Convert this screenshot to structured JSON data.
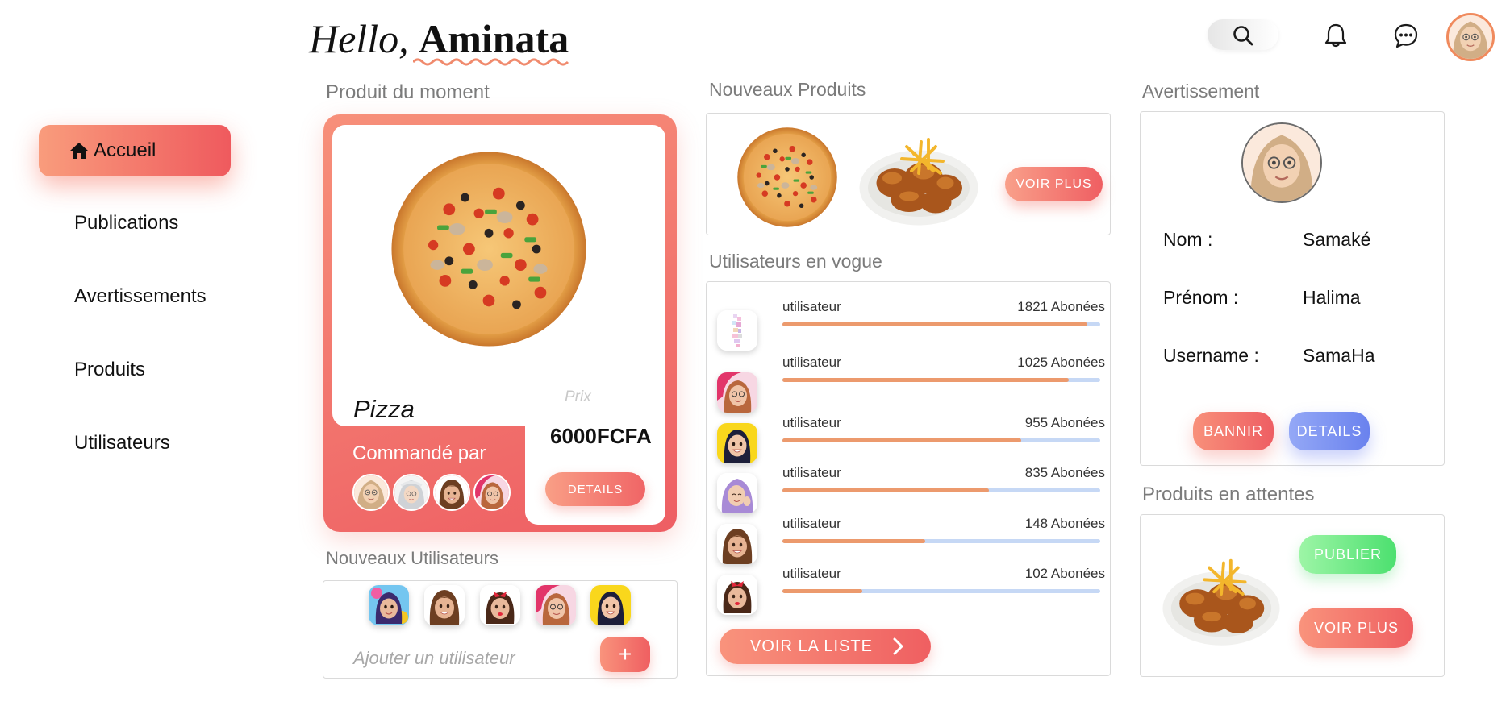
{
  "greeting": {
    "hello": "Hello,",
    "name": "Aminata"
  },
  "topbar": {
    "icons": [
      "search-icon",
      "bell-icon",
      "chat-icon",
      "avatar"
    ]
  },
  "sidebar": {
    "items": [
      {
        "label": "Accueil",
        "icon": "home-icon",
        "active": true
      },
      {
        "label": "Publications"
      },
      {
        "label": "Avertissements"
      },
      {
        "label": "Produits"
      },
      {
        "label": "Utilisateurs"
      }
    ]
  },
  "featured": {
    "title": "Produit du moment",
    "name": "Pizza",
    "price_label": "Prix",
    "price": "6000FCFA",
    "ordered_by_label": "Commandé par",
    "details_label": "DETAILS"
  },
  "new_users": {
    "title": "Nouveaux Utilisateurs",
    "add_placeholder": "Ajouter un utilisateur",
    "add_label": "+"
  },
  "new_products": {
    "title": "Nouveaux Produits",
    "more_label": "VOIR PLUS"
  },
  "trending": {
    "title": "Utilisateurs en vogue",
    "users": [
      {
        "name": "utilisateur",
        "followers": "1821 Abonées",
        "level": 0.96
      },
      {
        "name": "utilisateur",
        "followers": "1025 Abonées",
        "level": 0.9
      },
      {
        "name": "utilisateur",
        "followers": "955 Abonées",
        "level": 0.75
      },
      {
        "name": "utilisateur",
        "followers": "835 Abonées",
        "level": 0.65
      },
      {
        "name": "utilisateur",
        "followers": "148 Abonées",
        "level": 0.45
      },
      {
        "name": "utilisateur",
        "followers": "102 Abonées",
        "level": 0.25
      }
    ],
    "list_label": "VOIR LA LISTE"
  },
  "warning": {
    "title": "Avertissement",
    "fields": [
      {
        "key": "Nom :",
        "value": "Samaké"
      },
      {
        "key": "Prénom :",
        "value": "Halima"
      },
      {
        "key": "Username :",
        "value": "SamaHa"
      }
    ],
    "ban_label": "BANNIR",
    "details_label": "DETAILS"
  },
  "pending": {
    "title": "Produits en attentes",
    "publish_label": "PUBLIER",
    "more_label": "VOIR PLUS"
  },
  "colors": {
    "accent": "#ef5f61",
    "accent_light": "#f9937c",
    "blue": "#6a82ee",
    "green": "#4ce06f"
  }
}
